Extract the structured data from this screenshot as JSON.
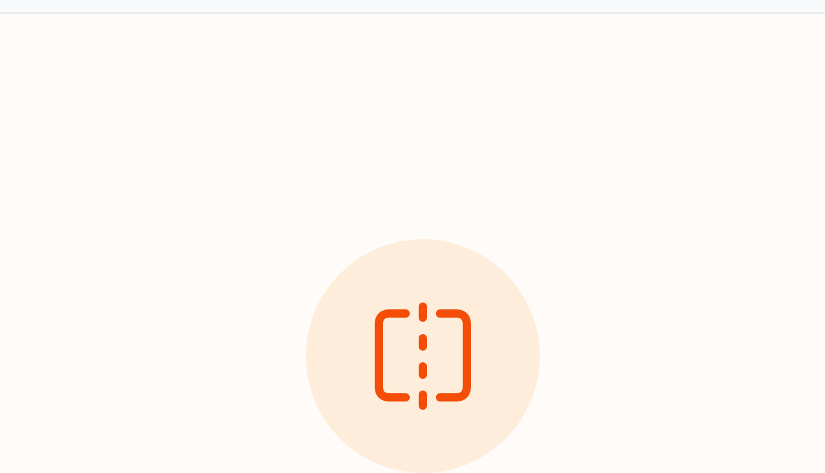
{
  "colors": {
    "page_background": "#fffbf8",
    "top_bar_background": "#f8f9fb",
    "top_bar_border": "#e6e8ec",
    "icon_circle": "#feeddb",
    "icon_accent": "#f44d08"
  },
  "icons": {
    "hero_icon": "split-view-icon"
  }
}
